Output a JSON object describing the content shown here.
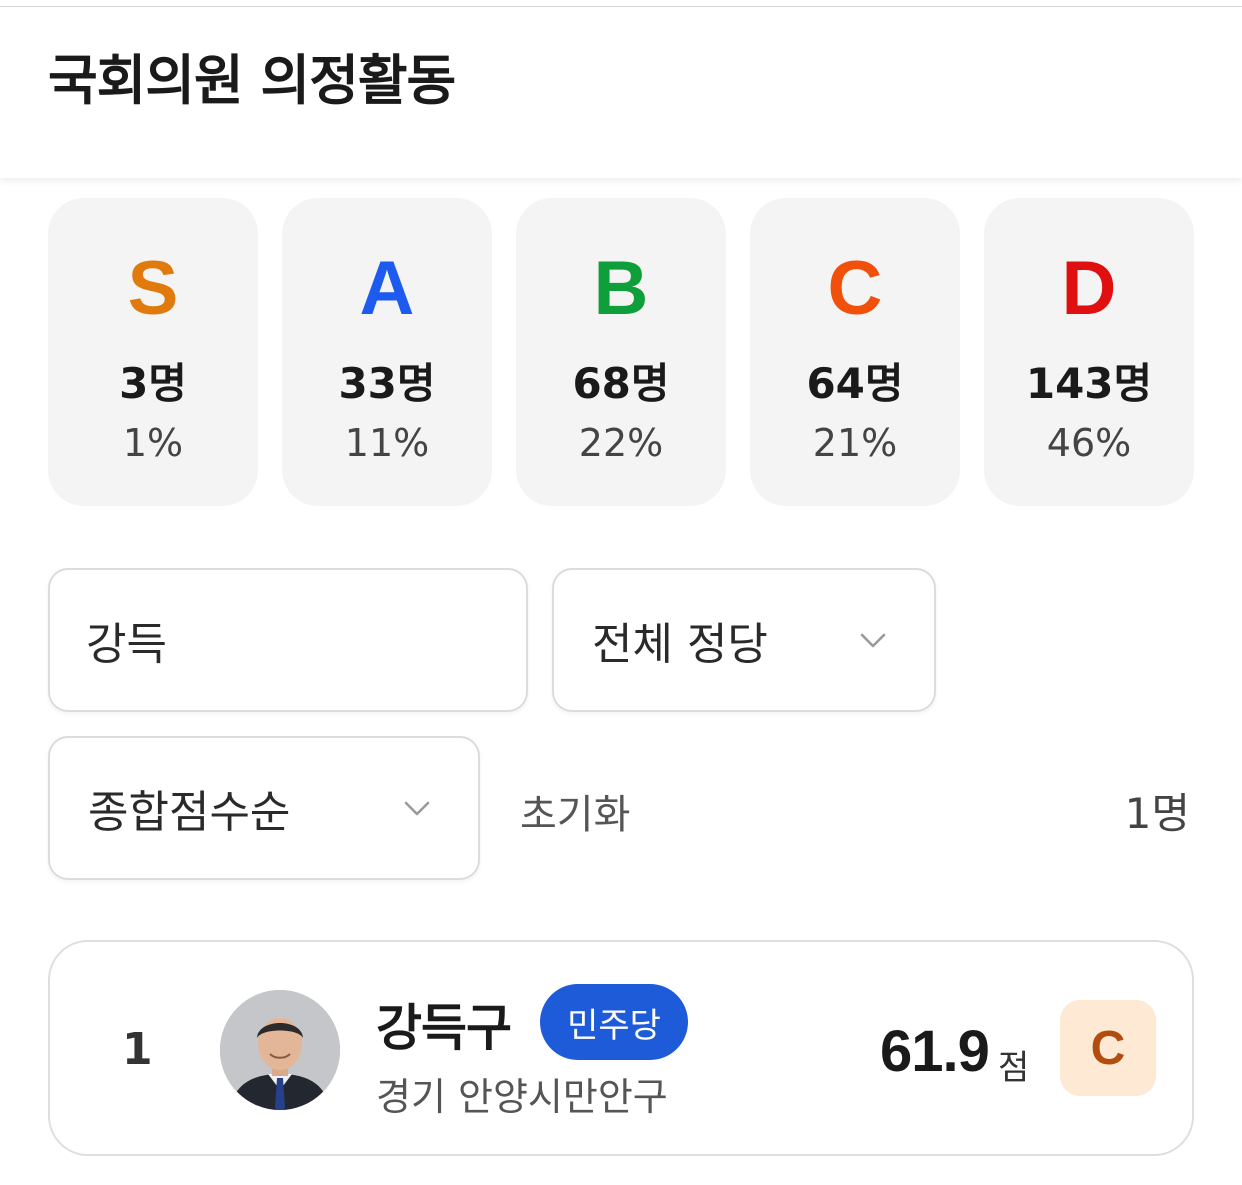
{
  "header": {
    "title": "국회의원 의정활동"
  },
  "grades": [
    {
      "letter": "S",
      "count": "3명",
      "percent": "1%",
      "color": "#e07a0c"
    },
    {
      "letter": "A",
      "count": "33명",
      "percent": "11%",
      "color": "#1d5bf0"
    },
    {
      "letter": "B",
      "count": "68명",
      "percent": "22%",
      "color": "#0f9f3a"
    },
    {
      "letter": "C",
      "count": "64명",
      "percent": "21%",
      "color": "#f0500a"
    },
    {
      "letter": "D",
      "count": "143명",
      "percent": "46%",
      "color": "#e01010"
    }
  ],
  "filters": {
    "search_value": "강득",
    "party_select": "전체 정당",
    "sort_select": "종합점수순",
    "reset_label": "초기화",
    "result_count": "1명"
  },
  "results": [
    {
      "rank": "1",
      "name": "강득구",
      "party": "민주당",
      "party_color": "#1d5bd8",
      "district": "경기 안양시만안구",
      "score": "61.9",
      "score_unit": "점",
      "grade": "C",
      "grade_badge_bg": "#fde9d4",
      "grade_badge_color": "#b24d0d"
    }
  ]
}
